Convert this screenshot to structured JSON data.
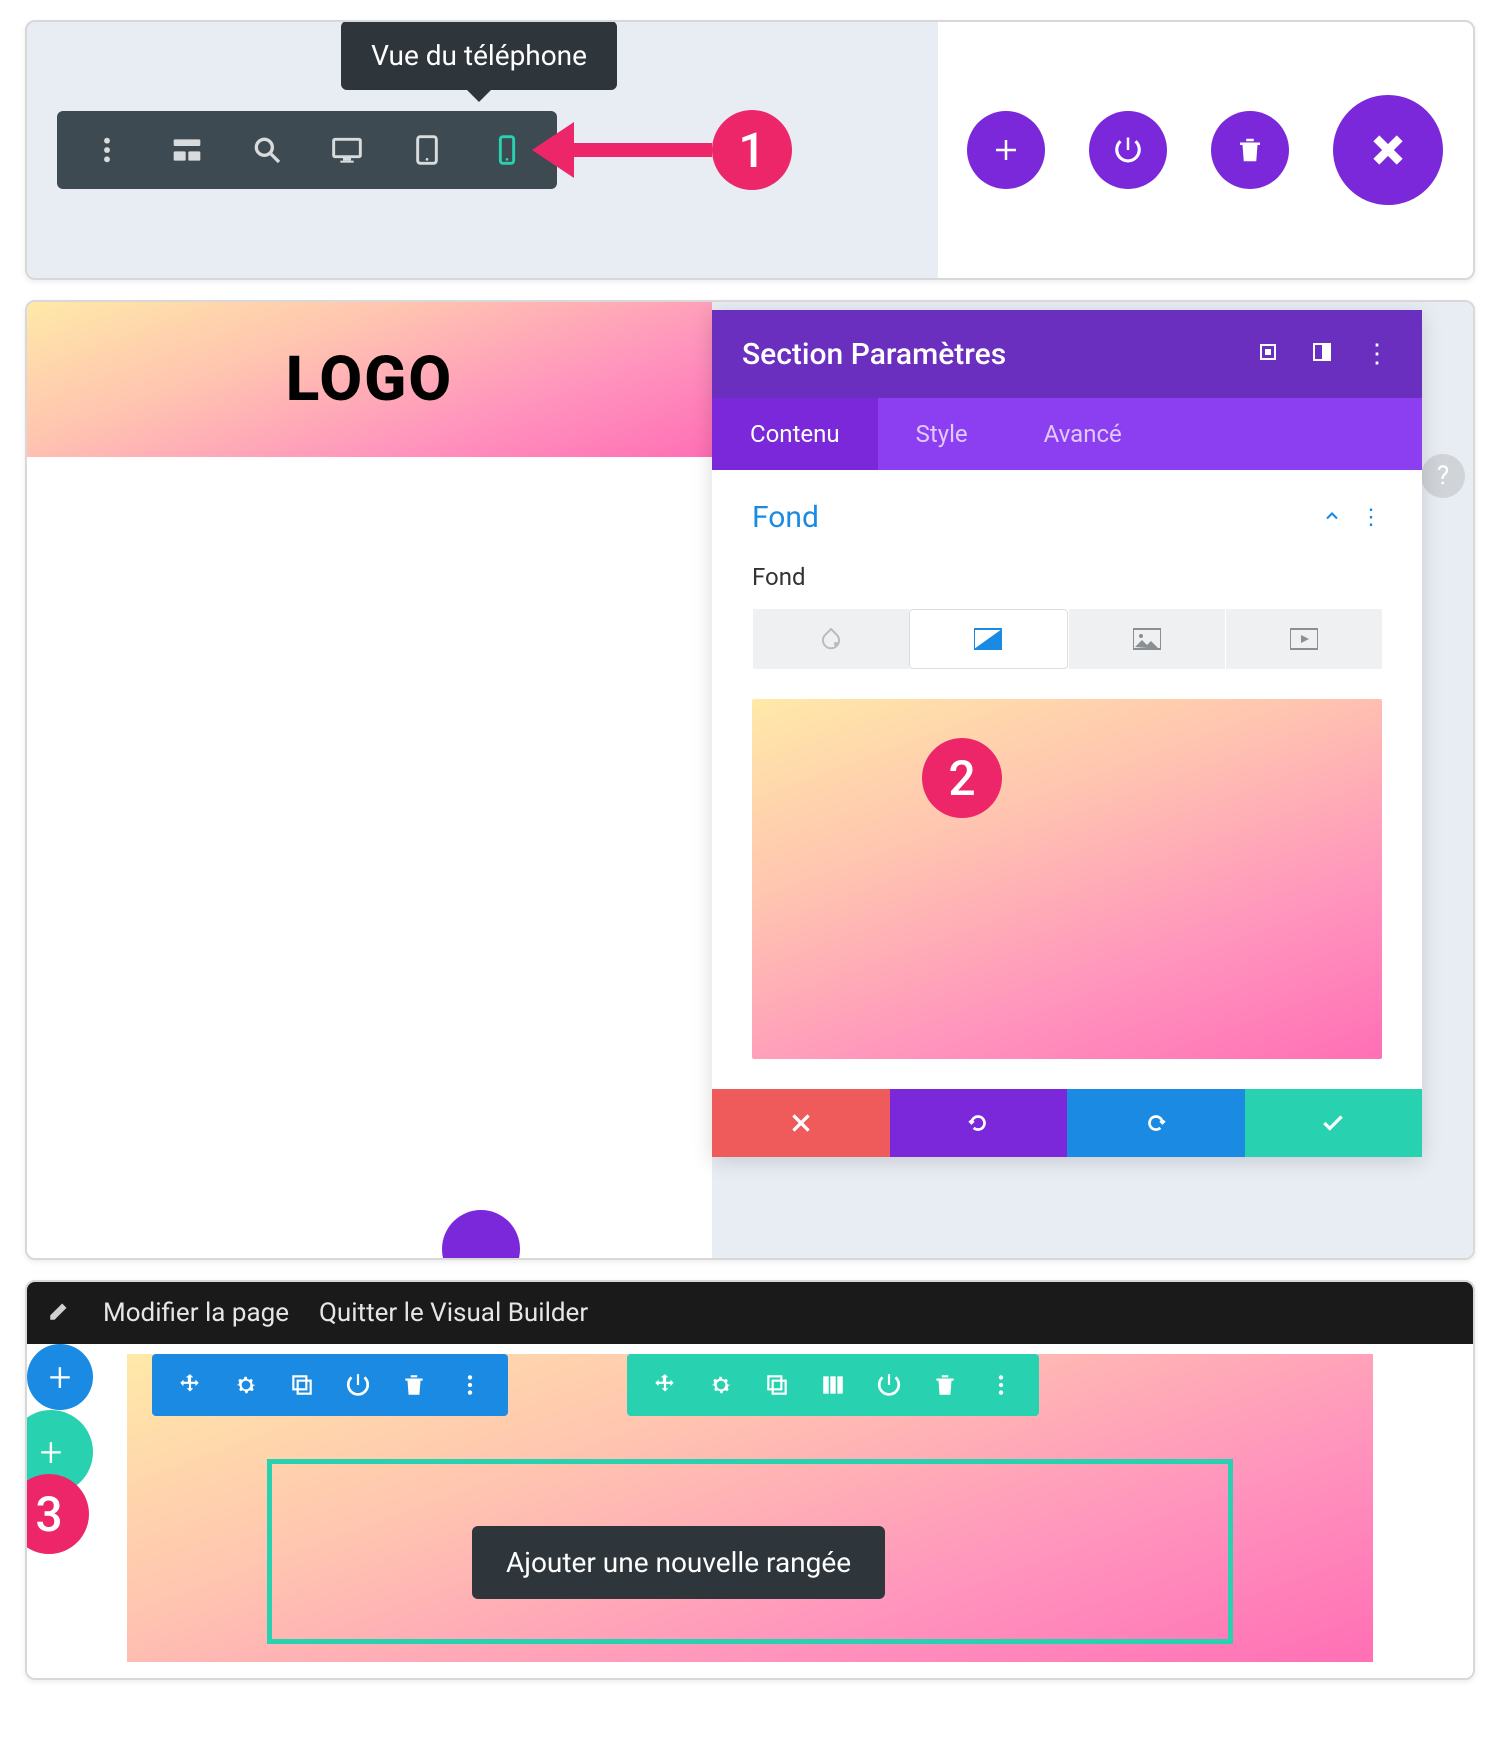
{
  "panel1": {
    "tooltip": "Vue du téléphone",
    "step": "1",
    "toolbar": {
      "more": "more-icon",
      "wireframe": "wireframe-icon",
      "zoom": "zoom-icon",
      "desktop": "desktop-icon",
      "tablet": "tablet-icon",
      "phone": "phone-icon"
    },
    "actions": {
      "add": "add-icon",
      "power": "power-icon",
      "delete": "trash-icon",
      "close": "close-icon"
    }
  },
  "panel2": {
    "logo": "LOGO",
    "settings_title": "Section Paramètres",
    "tabs": {
      "content": "Contenu",
      "style": "Style",
      "advanced": "Avancé"
    },
    "section": {
      "title": "Fond",
      "label": "Fond"
    },
    "bg_types": [
      "color",
      "gradient",
      "image",
      "video"
    ],
    "step": "2",
    "help": "?"
  },
  "panel3": {
    "topbar": {
      "edit": "Modifier la page",
      "quit": "Quitter le Visual Builder"
    },
    "tooltip": "Ajouter une nouvelle rangée",
    "step": "3",
    "add_plus": "+"
  }
}
